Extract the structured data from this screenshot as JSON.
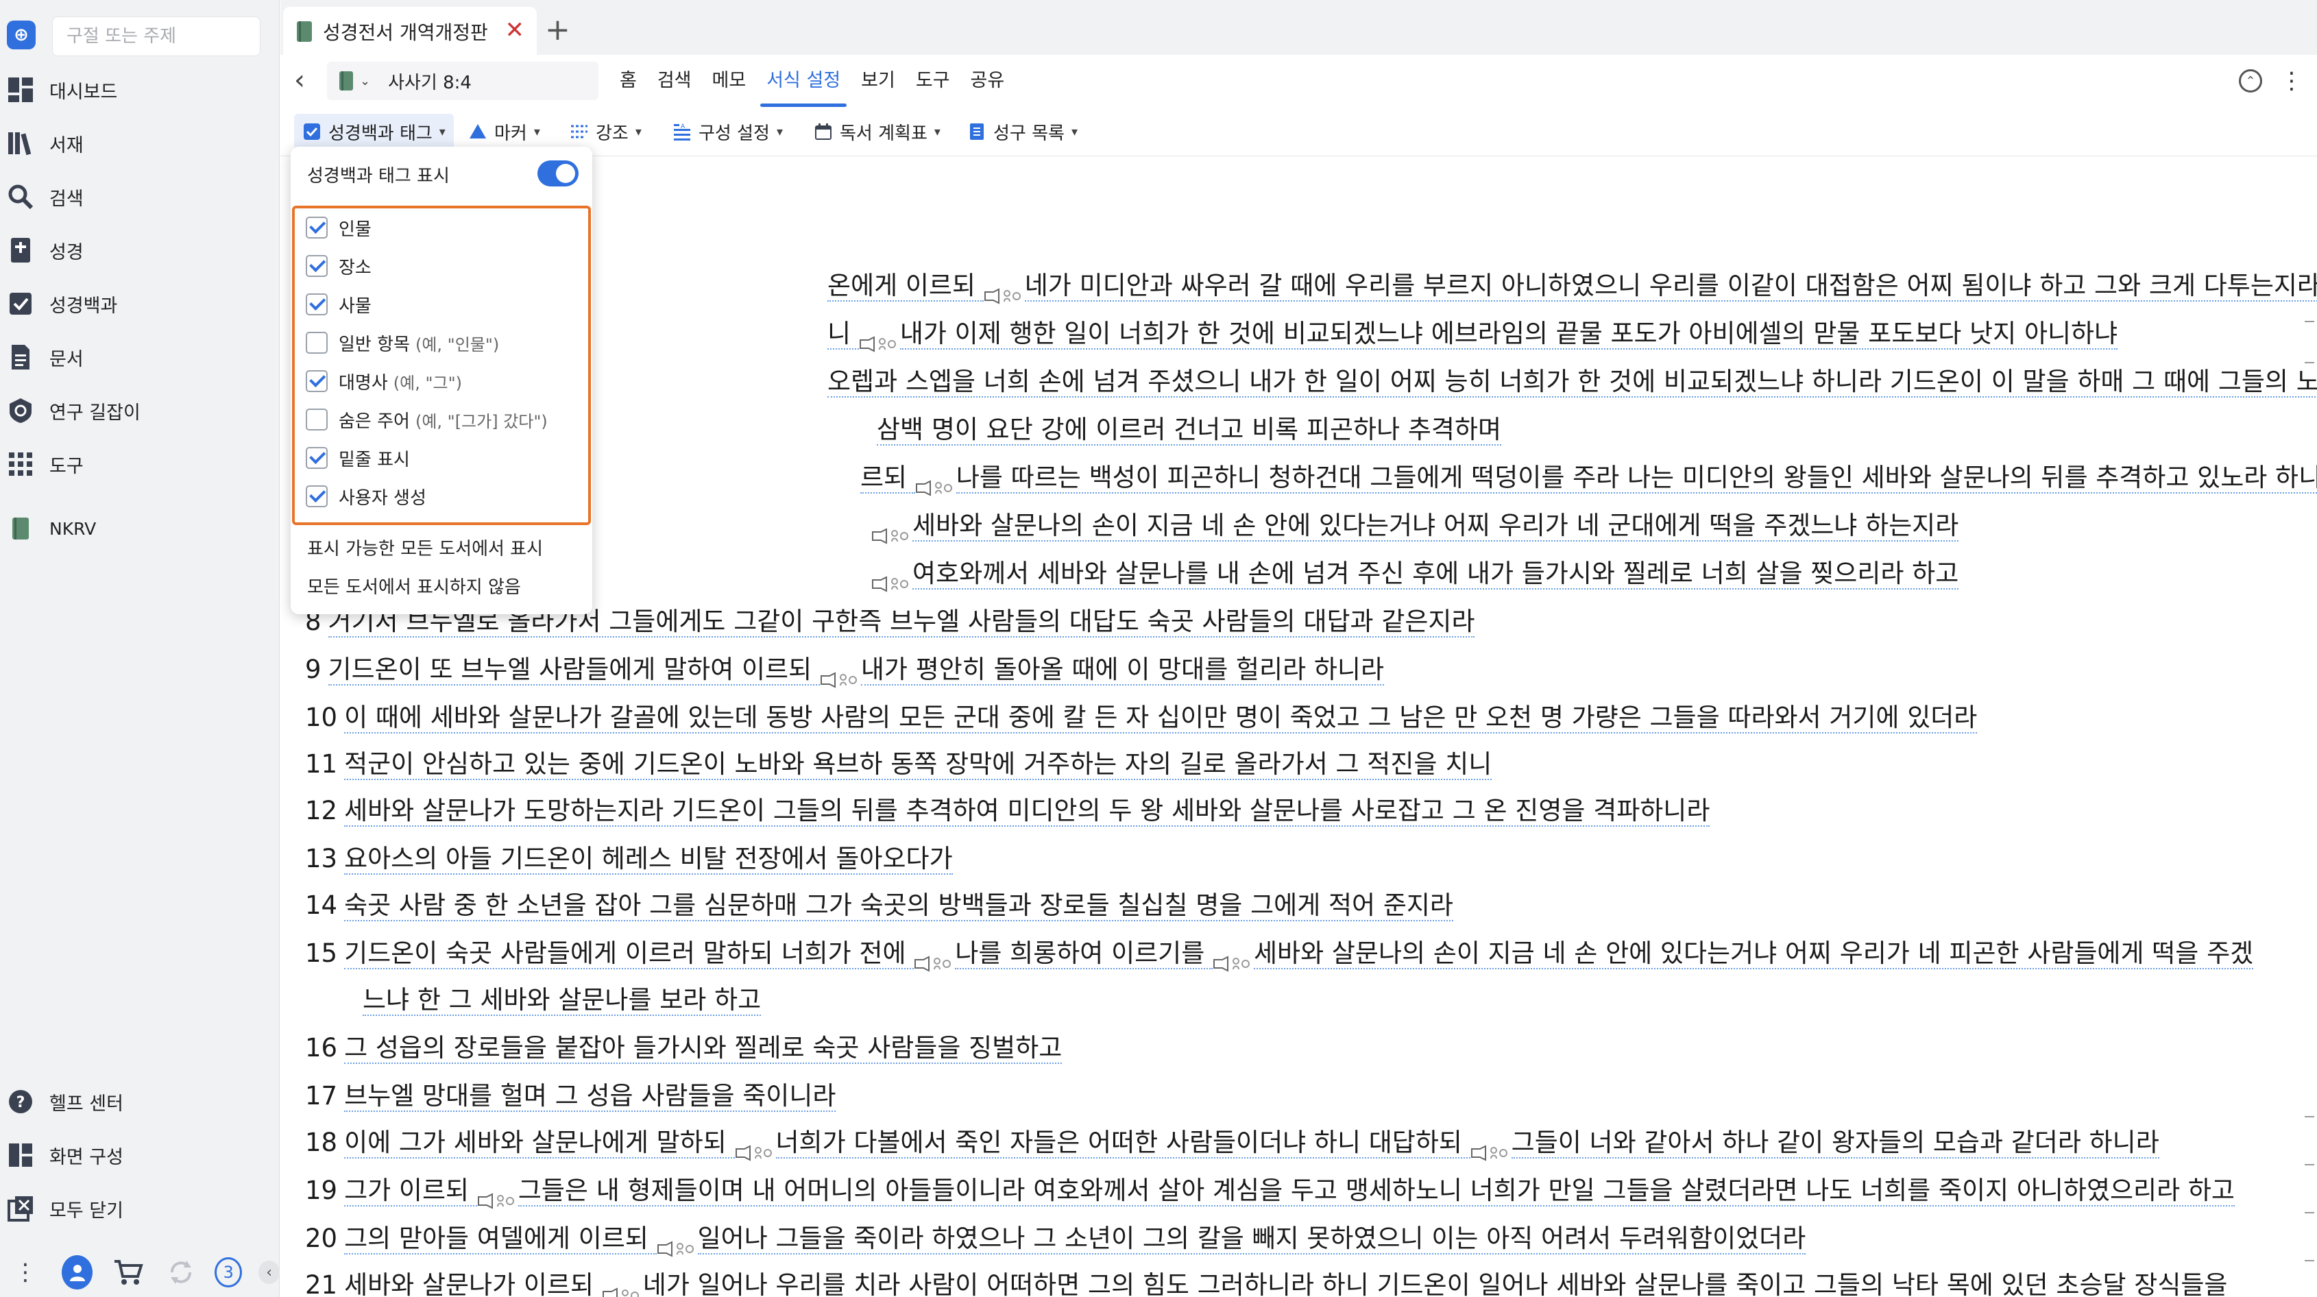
{
  "sidebar": {
    "search_placeholder": "구절 또는 주제",
    "items": [
      {
        "label": "대시보드",
        "icon": "dashboard-icon"
      },
      {
        "label": "서재",
        "icon": "library-icon"
      },
      {
        "label": "검색",
        "icon": "search-icon"
      },
      {
        "label": "성경",
        "icon": "bible-icon"
      },
      {
        "label": "성경백과",
        "icon": "encyclopedia-icon"
      },
      {
        "label": "문서",
        "icon": "document-icon"
      },
      {
        "label": "연구 길잡이",
        "icon": "study-guide-icon"
      },
      {
        "label": "도구",
        "icon": "tools-icon"
      },
      {
        "label": "NKRV",
        "icon": "book-icon"
      }
    ],
    "bottom_items": [
      {
        "label": "헬프 센터",
        "icon": "help-icon"
      },
      {
        "label": "화면 구성",
        "icon": "layout-icon"
      },
      {
        "label": "모두 닫기",
        "icon": "close-all-icon"
      }
    ],
    "badge_count": "3"
  },
  "tab": {
    "title": "성경전서 개역개정판",
    "close": "✕",
    "add": "+"
  },
  "nav": {
    "reference": "사사기 8:4",
    "menu": [
      "홈",
      "검색",
      "메모",
      "서식 설정",
      "보기",
      "도구",
      "공유"
    ],
    "active_menu": "서식 설정"
  },
  "toolbar": {
    "items": [
      "성경백과 태그",
      "마커",
      "강조",
      "구성 설정",
      "독서 계획표",
      "성구 목록"
    ]
  },
  "dropdown": {
    "header": "성경백과 태그 표시",
    "options": [
      {
        "label": "인물",
        "hint": "",
        "checked": true
      },
      {
        "label": "장소",
        "hint": "",
        "checked": true
      },
      {
        "label": "사물",
        "hint": "",
        "checked": true
      },
      {
        "label": "일반 항목",
        "hint": "(예, \"인물\")",
        "checked": false
      },
      {
        "label": "대명사",
        "hint": "(예, \"그\")",
        "checked": true
      },
      {
        "label": "숨은 주어",
        "hint": "(예, \"[그가] 갔다\")",
        "checked": false
      },
      {
        "label": "밑줄 표시",
        "hint": "",
        "checked": true
      },
      {
        "label": "사용자 생성",
        "hint": "",
        "checked": true
      }
    ],
    "footer": [
      "표시 가능한 모든 도서에서 표시",
      "모든 도서에서 표시하지 않음"
    ]
  },
  "verses": [
    {
      "n": "",
      "t": "온에게 이르되 ",
      "v": true,
      "r": "네가 미디안과 싸우러 갈 때에 우리를 부르지 아니하였으니 우리를 이같이 대접함은 어찌 됨이냐 하고 그와 크게 다투는지라"
    },
    {
      "n": "",
      "t": "니 ",
      "v": true,
      "r": "내가 이제 행한 일이 너희가 한 것에 비교되겠느냐 에브라임의 끝물 포도가 아비에셀의 맏물 포도보다 낫지 아니하냐"
    },
    {
      "n": "",
      "t": "오렙과 스엡을 너희 손에 넘겨 주셨으니 내가 한 일이 어찌 능히 너희가 한 것에 비교되겠느냐 하니라 기드온이 이 말을 하매 그 때에 그들의 노여움이 풀리니라",
      "v": false,
      "r": ""
    },
    {
      "n": "",
      "t": "삼백 명이 요단 강에 이르러 건너고 비록 피곤하나 추격하며",
      "v": false,
      "r": ""
    },
    {
      "n": "",
      "t": "르되 ",
      "v": true,
      "r": "나를 따르는 백성이 피곤하니 청하건대 그들에게 떡덩이를 주라 나는 미디안의 왕들인 세바와 살문나의 뒤를 추격하고 있노라 하니"
    },
    {
      "n": "",
      "t": "",
      "v": true,
      "r": "세바와 살문나의 손이 지금 네 손 안에 있다는거냐 어찌 우리가 네 군대에게 떡을 주겠느냐 하는지라"
    },
    {
      "n": "",
      "t": "",
      "v": true,
      "r": "여호와께서 세바와 살문나를 내 손에 넘겨 주신 후에 내가 들가시와 찔레로 너희 살을 찢으리라 하고"
    },
    {
      "n": "8",
      "t": "거기서 브누엘로 올라가서 그들에게도 그같이 구한즉 브누엘 사람들의 대답도 숙곳 사람들의 대답과 같은지라",
      "v": false,
      "r": ""
    },
    {
      "n": "9",
      "t": "기드온이 또 브누엘 사람들에게 말하여 이르되 ",
      "v": true,
      "r": "내가 평안히 돌아올 때에 이 망대를 헐리라 하니라"
    },
    {
      "n": "10",
      "t": "이 때에 세바와 살문나가 갈골에 있는데 동방 사람의 모든 군대 중에 칼 든 자 십이만 명이 죽었고 그 남은 만 오천 명 가량은 그들을 따라와서 거기에 있더라",
      "v": false,
      "r": ""
    },
    {
      "n": "11",
      "t": "적군이 안심하고 있는 중에 기드온이 노바와 욕브하 동쪽 장막에 거주하는 자의 길로 올라가서 그 적진을 치니",
      "v": false,
      "r": ""
    },
    {
      "n": "12",
      "t": "세바와 살문나가 도망하는지라 기드온이 그들의 뒤를 추격하여 미디안의 두 왕 세바와 살문나를 사로잡고 그 온 진영을 격파하니라",
      "v": false,
      "r": ""
    },
    {
      "n": "13",
      "t": "요아스의 아들 기드온이 헤레스 비탈 전장에서 돌아오다가",
      "v": false,
      "r": ""
    },
    {
      "n": "14",
      "t": "숙곳 사람 중 한 소년을 잡아 그를 심문하매 그가 숙곳의 방백들과 장로들 칠십칠 명을 그에게 적어 준지라",
      "v": false,
      "r": ""
    },
    {
      "n": "15",
      "t": "기드온이 숙곳 사람들에게 이르러 말하되 너희가 전에 ",
      "v": true,
      "r": "나를 희롱하여 이르기를 ",
      "v2": true,
      "r2": "세바와 살문나의 손이 지금 네 손 안에 있다는거냐 어찌 우리가 네 피곤한 사람들에게 떡을 주겠"
    },
    {
      "n": "",
      "t": "느냐 한 그 세바와 살문나를 보라 하고",
      "v": false,
      "r": "",
      "indent": true
    },
    {
      "n": "16",
      "t": "그 성읍의 장로들을 붙잡아 들가시와 찔레로 숙곳 사람들을 징벌하고",
      "v": false,
      "r": ""
    },
    {
      "n": "17",
      "t": "브누엘 망대를 헐며 그 성읍 사람들을 죽이니라",
      "v": false,
      "r": ""
    },
    {
      "n": "18",
      "t": "이에 그가 세바와 살문나에게 말하되 ",
      "v": true,
      "r": "너희가 다볼에서 죽인 자들은 어떠한 사람들이더냐 하니 대답하되 ",
      "v2": true,
      "r2": "그들이 너와 같아서 하나 같이 왕자들의 모습과 같더라 하니라"
    },
    {
      "n": "19",
      "t": "그가 이르되 ",
      "v": true,
      "r": "그들은 내 형제들이며 내 어머니의 아들들이니라 여호와께서 살아 계심을 두고 맹세하노니 너희가 만일 그들을 살렸더라면 나도 너희를 죽이지 아니하였으리라 하고"
    },
    {
      "n": "20",
      "t": "그의 맏아들 여델에게 이르되 ",
      "v": true,
      "r": "일어나 그들을 죽이라 하였으나 그 소년이 그의 칼을 빼지 못하였으니 이는 아직 어려서 두려워함이었더라"
    },
    {
      "n": "21",
      "t": "세바와 살문나가 이르되 ",
      "v": true,
      "r": "네가 일어나 우리를 치라 사람이 어떠하면 그의 힘도 그러하니라 하니 기드온이 일어나 세바와 살문나를 죽이고 그들의 낙타 목에 있던 초승달 장식들을"
    }
  ],
  "colors": {
    "accent": "#2f6fde",
    "highlight_border": "#e8742a"
  }
}
